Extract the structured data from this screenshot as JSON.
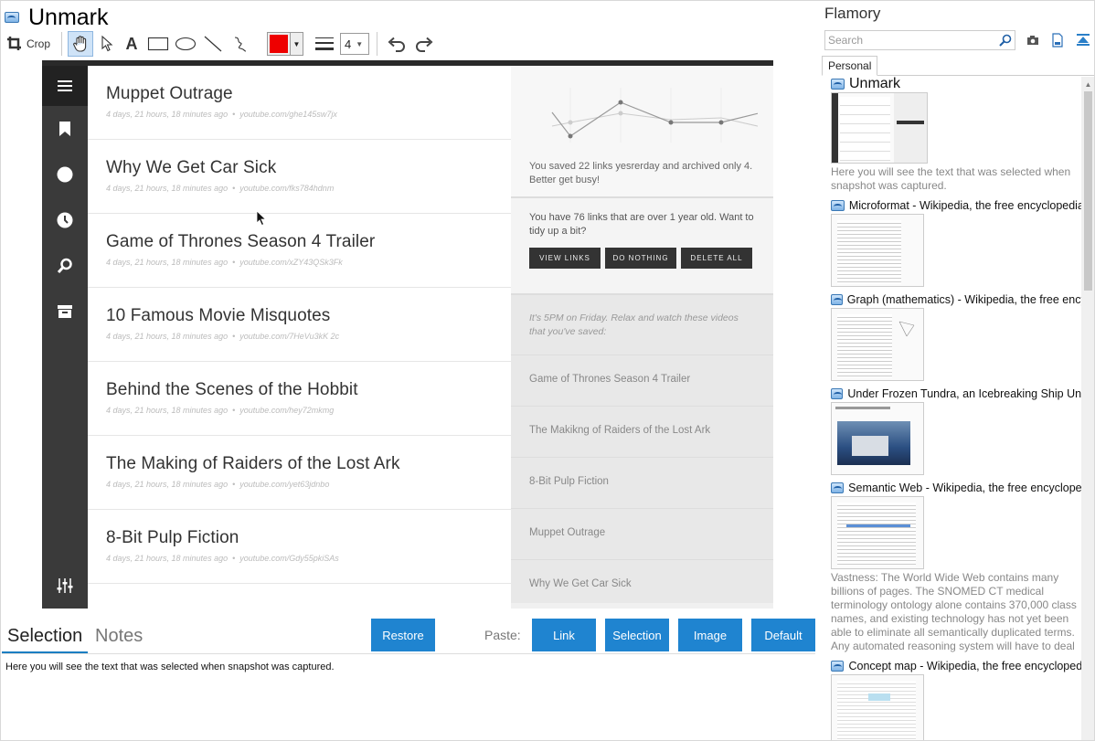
{
  "window": {
    "title": "Unmark"
  },
  "toolbar": {
    "crop_label": "Crop",
    "pen_width": "4",
    "current_color": "#e00000",
    "tools": [
      "hand-icon",
      "pointer-icon",
      "text-icon",
      "rectangle-icon",
      "ellipse-icon",
      "line-icon",
      "freehand-icon"
    ]
  },
  "snapshot": {
    "links": [
      {
        "title": "Muppet Outrage",
        "age": "4 days, 21 hours, 18 minutes ago",
        "url": "youtube.com/ghe145sw7jx"
      },
      {
        "title": "Why We Get Car Sick",
        "age": "4 days, 21 hours, 18 minutes ago",
        "url": "youtube.com/fks784hdnm"
      },
      {
        "title": "Game of Thrones Season 4 Trailer",
        "age": "4 days, 21 hours, 18 minutes ago",
        "url": "youtube.com/xZY43QSk3Fk"
      },
      {
        "title": "10 Famous Movie Misquotes",
        "age": "4 days, 21 hours, 18 minutes ago",
        "url": "youtube.com/7HeVu3kK 2c"
      },
      {
        "title": "Behind the Scenes of the Hobbit",
        "age": "4 days, 21 hours, 18 minutes ago",
        "url": "youtube.com/hey72mkmg"
      },
      {
        "title": "The Making of Raiders of the Lost Ark",
        "age": "4 days, 21 hours, 18 minutes ago",
        "url": "youtube.com/yet63jdnbo"
      },
      {
        "title": "8-Bit Pulp Fiction",
        "age": "4 days, 21 hours, 18 minutes ago",
        "url": "youtube.com/Gdy55pkiSAs"
      }
    ],
    "stats_text": "You saved 22 links yesrerday and archived only 4. Better get busy!",
    "old_links_text": "You have 76 links that are over 1 year old. Want to tidy up a bit?",
    "buttons": {
      "view": "VIEW LINKS",
      "nothing": "DO NOTHING",
      "delete": "DELETE ALL"
    },
    "friday_text": "It's 5PM on Friday. Relax and watch these videos that you've saved:",
    "videos": [
      "Game of Thrones Season 4 Trailer",
      "The Makikng of Raiders of the Lost Ark",
      "8-Bit Pulp Fiction",
      "Muppet Outrage",
      "Why We Get Car Sick"
    ]
  },
  "bottom": {
    "tab_selection": "Selection",
    "tab_notes": "Notes",
    "restore": "Restore",
    "paste_label": "Paste:",
    "paste_link": "Link",
    "paste_selection": "Selection",
    "paste_image": "Image",
    "paste_default": "Default",
    "selection_text": "Here you will see the text that was selected when snapshot was captured."
  },
  "right": {
    "app_name": "Flamory",
    "search_placeholder": "Search",
    "tab_personal": "Personal",
    "entries": [
      {
        "title": "Unmark",
        "desc": "Here you will see the text that was selected when snapshot was captured."
      },
      {
        "title": "Microformat - Wikipedia, the free encyclopedia",
        "desc": ""
      },
      {
        "title": "Graph (mathematics) - Wikipedia, the free encyclopedia",
        "desc": ""
      },
      {
        "title": "Under Frozen Tundra, an Icebreaking Ship Uncovers",
        "desc": ""
      },
      {
        "title": "Semantic Web - Wikipedia, the free encyclopedia",
        "desc": "Vastness: The World Wide Web contains many billions of pages. The SNOMED CT medical terminology ontology alone contains 370,000 class names, and existing technology has not yet been able to eliminate all semantically duplicated terms. Any automated reasoning system will have to deal with truly huge inputs."
      },
      {
        "title": "Concept map - Wikipedia, the free encyclopedia",
        "desc": ""
      }
    ]
  }
}
